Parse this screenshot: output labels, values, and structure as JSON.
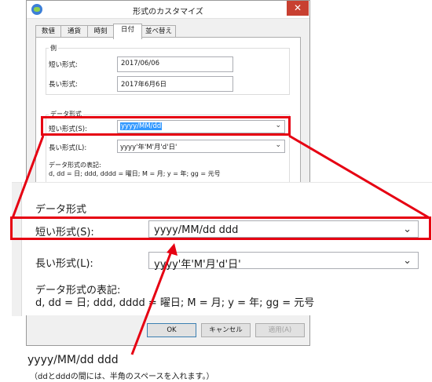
{
  "window": {
    "title": "形式のカスタマイズ",
    "close_symbol": "✕",
    "tabs": [
      "数値",
      "通貨",
      "時刻",
      "日付",
      "並べ替え"
    ],
    "active_tab": "日付"
  },
  "example": {
    "group_title": "例",
    "short_label": "短い形式:",
    "short_value": "2017/06/06",
    "long_label": "長い形式:",
    "long_value": "2017年6月6日"
  },
  "data_format": {
    "group_title": "データ形式",
    "short_label": "短い形式(S):",
    "short_value": "yyyy/MM/dd",
    "long_label": "長い形式(L):",
    "long_value": "yyyy'年'M'月'd'日'",
    "notation_title": "データ形式の表記:",
    "notation_text": "d, dd = 日;  ddd, dddd = 曜日; M = 月; y = 年; gg = 元号"
  },
  "zoom": {
    "group_title": "データ形式",
    "short_label": "短い形式(S):",
    "short_value": "yyyy/MM/dd ddd",
    "long_label": "長い形式(L):",
    "long_value": "yyyy'年'M'月'd'日'",
    "notation_title": "データ形式の表記:",
    "notation_text": "d, dd = 日;  ddd, dddd = 曜日; M = 月; y = 年; gg = 元号"
  },
  "buttons": {
    "ok": "OK",
    "cancel": "キャンセル",
    "apply": "適用(A)"
  },
  "annotation": {
    "caption": "yyyy/MM/dd ddd",
    "note": "（ddとdddの間には、半角のスペースを入れます。）"
  },
  "colors": {
    "highlight_red": "#e60012",
    "selection_blue": "#3399ff",
    "close_red": "#c84031"
  },
  "icons": [
    "app-icon",
    "close-icon",
    "chevron-down-icon"
  ]
}
